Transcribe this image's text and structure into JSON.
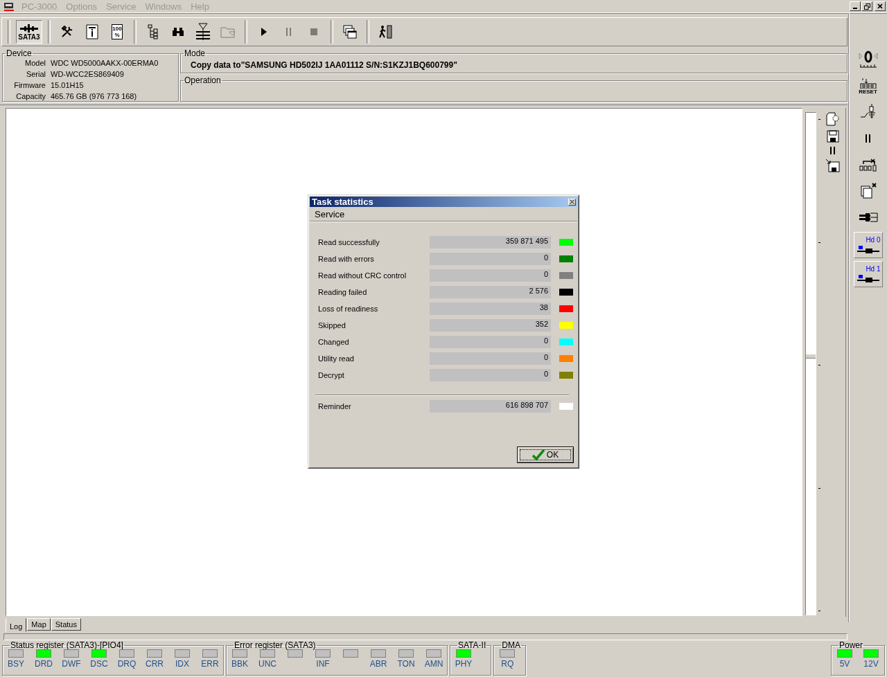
{
  "menu": [
    {
      "label": "PC-3000",
      "disabled": true
    },
    {
      "label": "Options",
      "disabled": true
    },
    {
      "label": "Service",
      "disabled": true
    },
    {
      "label": "Windows",
      "disabled": true
    },
    {
      "label": "Help",
      "disabled": true
    }
  ],
  "toolbar": [
    [
      {
        "kind": "sata",
        "label": "SATA3",
        "selected": true,
        "disabled": false
      }
    ],
    [
      {
        "kind": "tools",
        "selected": false,
        "disabled": false
      },
      {
        "kind": "info",
        "selected": false,
        "disabled": false
      },
      {
        "kind": "percent",
        "label": "100 %",
        "selected": false,
        "disabled": false
      }
    ],
    [
      {
        "kind": "tree",
        "selected": false,
        "disabled": false
      },
      {
        "kind": "binoculars",
        "selected": false,
        "disabled": false
      },
      {
        "kind": "filter",
        "selected": false,
        "disabled": false
      },
      {
        "kind": "folder",
        "selected": false,
        "disabled": true
      }
    ],
    [
      {
        "kind": "play",
        "selected": false,
        "disabled": false
      },
      {
        "kind": "pause",
        "selected": false,
        "disabled": true
      },
      {
        "kind": "stop",
        "selected": false,
        "disabled": true
      }
    ],
    [
      {
        "kind": "windows",
        "selected": false,
        "disabled": false
      }
    ],
    [
      {
        "kind": "exit",
        "selected": false,
        "disabled": false
      }
    ]
  ],
  "device": {
    "title": "Device",
    "fields": [
      {
        "label": "Model",
        "value": "WDC WD5000AAKX-00ERMA0"
      },
      {
        "label": "Serial",
        "value": "WD-WCC2ES869409"
      },
      {
        "label": "Firmware",
        "value": "15.01H15"
      },
      {
        "label": "Capacity",
        "value": "465.76 GB (976 773 168)"
      }
    ]
  },
  "mode": {
    "title": "Mode",
    "value": "Copy data to\"SAMSUNG HD502IJ 1AA01112 S/N:S1KZJ1BQ600799\""
  },
  "operation": {
    "title": "Operation"
  },
  "side_tools": [
    {
      "kind": "doc-gear"
    },
    {
      "kind": "save"
    },
    {
      "kind": "pause"
    },
    {
      "kind": "save-import"
    }
  ],
  "scale_slider": {
    "level": 0.51
  },
  "log_tabs": [
    {
      "label": "Log",
      "selected": true
    },
    {
      "label": "Map",
      "selected": false
    },
    {
      "label": "Status",
      "selected": false
    }
  ],
  "right_toolbar": [
    {
      "kind": "gauge"
    },
    {
      "kind": "reset",
      "label": "RESET"
    },
    {
      "kind": "switch"
    },
    {
      "kind": "pause"
    },
    {
      "kind": "reset-x"
    },
    {
      "kind": "copy-x"
    },
    {
      "kind": "connector"
    },
    {
      "kind": "drive",
      "label": "Hd 0"
    },
    {
      "kind": "drive",
      "label": "Hd 1"
    }
  ],
  "registers": [
    {
      "title": "Status register (SATA3)-[PIO4]",
      "leds": [
        {
          "label": "BSY",
          "on": false
        },
        {
          "label": "DRD",
          "on": true
        },
        {
          "label": "DWF",
          "on": false
        },
        {
          "label": "DSC",
          "on": true
        },
        {
          "label": "DRQ",
          "on": false
        },
        {
          "label": "CRR",
          "on": false
        },
        {
          "label": "IDX",
          "on": false
        },
        {
          "label": "ERR",
          "on": false
        }
      ]
    },
    {
      "title": "Error register (SATA3)",
      "leds": [
        {
          "label": "BBK",
          "on": false
        },
        {
          "label": "UNC",
          "on": false
        },
        {
          "on": false
        },
        {
          "label": "INF",
          "on": false
        },
        {
          "on": false
        },
        {
          "label": "ABR",
          "on": false
        },
        {
          "label": "TON",
          "on": false
        },
        {
          "label": "AMN",
          "on": false
        }
      ]
    },
    {
      "title": "SATA-II",
      "leds": [
        {
          "label": "PHY",
          "on": true
        }
      ]
    },
    {
      "title": "DMA",
      "leds": [
        {
          "label": "RQ",
          "on": false
        }
      ]
    }
  ],
  "power": {
    "title": "Power",
    "leds": [
      {
        "label": "5V",
        "on": true
      },
      {
        "label": "12V",
        "on": true
      }
    ]
  },
  "dialog": {
    "title": "Task statistics",
    "menu": [
      "Service"
    ],
    "rows": [
      {
        "label": "Read successfully",
        "value": "359 871 495",
        "color": "#00ff00"
      },
      {
        "label": "Read with errors",
        "value": "0",
        "color": "#008000"
      },
      {
        "label": "Read without CRC control",
        "value": "0",
        "color": "#808080"
      },
      {
        "label": "Reading failed",
        "value": "2 576",
        "color": "#000000"
      },
      {
        "label": "Loss of readiness",
        "value": "38",
        "color": "#ff0000"
      },
      {
        "label": "Skipped",
        "value": "352",
        "color": "#ffff00"
      },
      {
        "label": "Changed",
        "value": "0",
        "color": "#00ffff"
      },
      {
        "label": "Utility read",
        "value": "0",
        "color": "#ff8000"
      },
      {
        "label": "Decrypt",
        "value": "0",
        "color": "#808000"
      }
    ],
    "total": {
      "label": "Reminder",
      "value": "616 898 707",
      "color": "#ffffff"
    },
    "ok_button": "OK"
  }
}
